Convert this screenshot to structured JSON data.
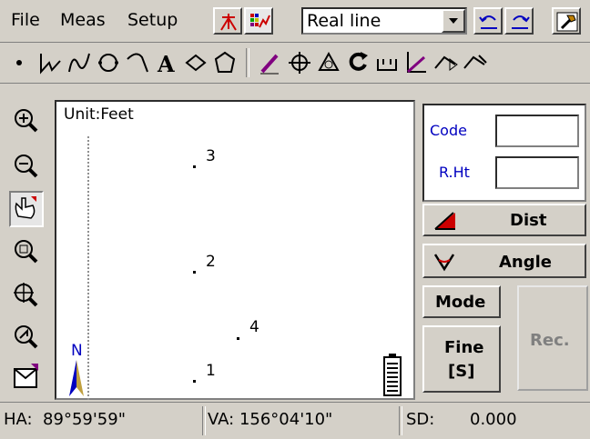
{
  "menu": {
    "file": "File",
    "meas": "Meas",
    "setup": "Setup"
  },
  "combo": {
    "value": "Real line"
  },
  "canvas": {
    "unit": "Unit:Feet",
    "north": "N",
    "points": [
      {
        "label": "3"
      },
      {
        "label": "2"
      },
      {
        "label": "4"
      },
      {
        "label": "1"
      }
    ]
  },
  "panel": {
    "code_label": "Code",
    "rht_label": "R.Ht",
    "dist_label": "Dist",
    "angle_label": "Angle",
    "mode_label": "Mode",
    "fine_label": "Fine",
    "fine_sub": "[S]",
    "rec_label": "Rec."
  },
  "status": {
    "ha": "HA:  89°59'59\"",
    "va": "VA: 156°04'10\"",
    "sd_label": "SD:",
    "sd_value": "0.000"
  },
  "colors": {
    "accent_blue": "#0000c0",
    "red": "#cc0000"
  }
}
